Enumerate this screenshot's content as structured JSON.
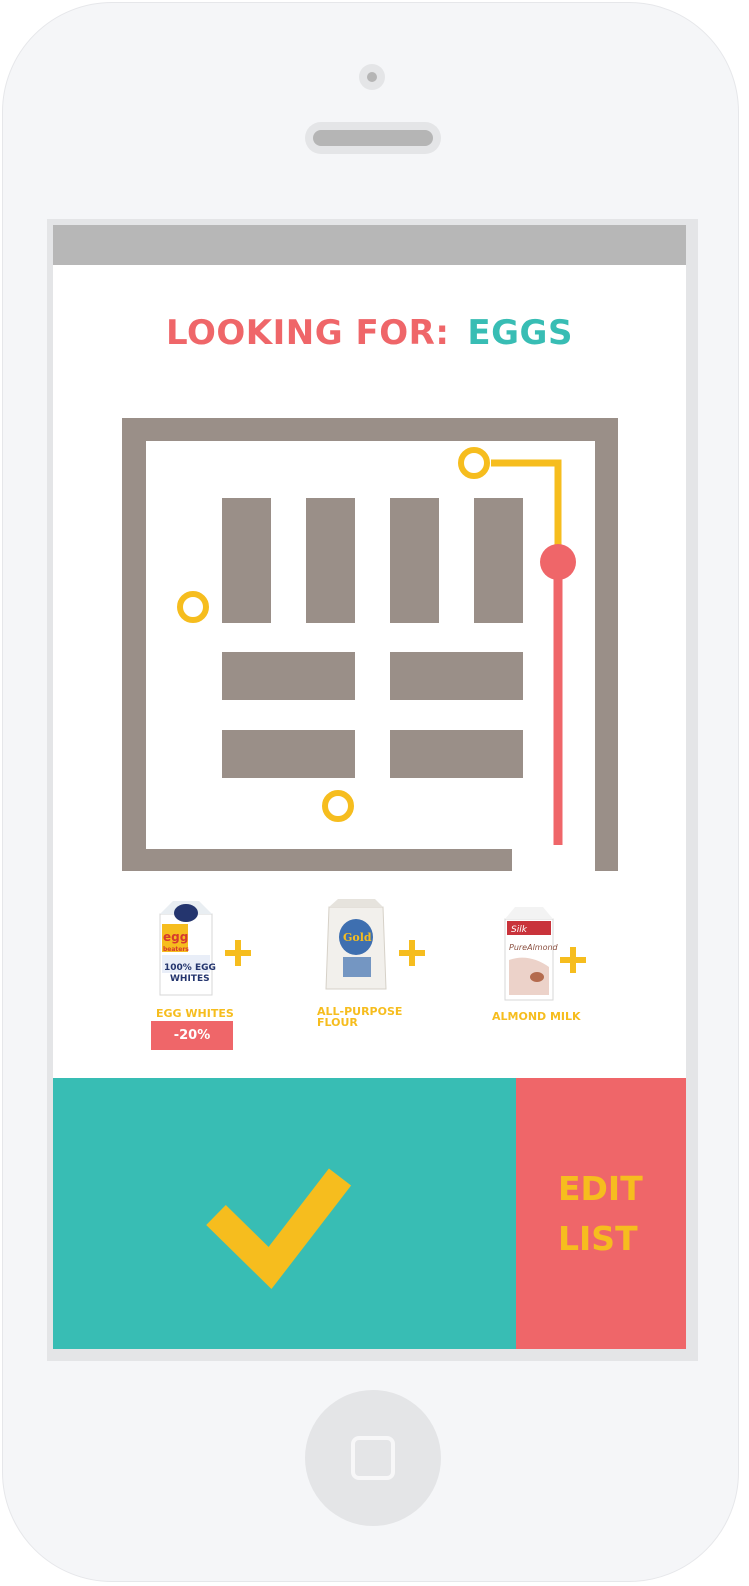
{
  "colors": {
    "accent_red": "#ef6669",
    "accent_teal": "#38bdb4",
    "accent_yellow": "#f6bd1e",
    "map_gray": "#9a8f88"
  },
  "search": {
    "label": "LOOKING FOR:",
    "item": "EGGS"
  },
  "products": [
    {
      "name": "EGG WHITES",
      "icon": "egg-whites-carton-image",
      "add_icon": "plus-icon"
    },
    {
      "name": "ALL-PURPOSE\nFLOUR",
      "icon": "flour-bag-image",
      "add_icon": "plus-icon"
    },
    {
      "name": "ALMOND MILK",
      "icon": "almond-milk-carton-image",
      "add_icon": "plus-icon"
    }
  ],
  "discount": "-20%",
  "actions": {
    "confirm_icon": "checkmark-icon",
    "edit_label": "EDIT\nLIST"
  }
}
